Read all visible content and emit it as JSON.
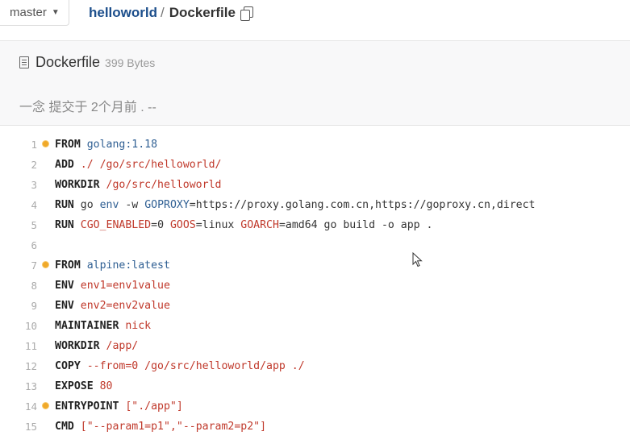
{
  "topbar": {
    "branch": "master",
    "repo": "helloworld",
    "separator": "/",
    "file": "Dockerfile"
  },
  "file_header": {
    "name": "Dockerfile",
    "size": "399 Bytes",
    "commit": "一念 提交于 2个月前 . --"
  },
  "code": {
    "lines": [
      {
        "n": "1",
        "marker": true,
        "segs": [
          [
            "kw",
            "FROM"
          ],
          [
            "plain",
            " "
          ],
          [
            "nm",
            "golang:1.18"
          ]
        ]
      },
      {
        "n": "2",
        "marker": false,
        "segs": [
          [
            "kw",
            "ADD"
          ],
          [
            "plain",
            " "
          ],
          [
            "arg",
            "./ /go/src/helloworld/"
          ]
        ]
      },
      {
        "n": "3",
        "marker": false,
        "segs": [
          [
            "kw",
            "WORKDIR"
          ],
          [
            "plain",
            " "
          ],
          [
            "arg",
            "/go/src/helloworld"
          ]
        ]
      },
      {
        "n": "4",
        "marker": false,
        "segs": [
          [
            "kw",
            "RUN"
          ],
          [
            "plain",
            " go "
          ],
          [
            "nm",
            "env"
          ],
          [
            "plain",
            " -w "
          ],
          [
            "nm",
            "GOPROXY"
          ],
          [
            "plain",
            "=https://proxy.golang.com.cn,https://goproxy.cn,direct"
          ]
        ]
      },
      {
        "n": "5",
        "marker": false,
        "segs": [
          [
            "kw",
            "RUN"
          ],
          [
            "plain",
            " "
          ],
          [
            "arg",
            "CGO_ENABLED"
          ],
          [
            "plain",
            "=0 "
          ],
          [
            "arg",
            "GOOS"
          ],
          [
            "plain",
            "=linux "
          ],
          [
            "arg",
            "GOARCH"
          ],
          [
            "plain",
            "=amd64 go build -o app ."
          ]
        ]
      },
      {
        "n": "6",
        "marker": false,
        "segs": []
      },
      {
        "n": "7",
        "marker": true,
        "segs": [
          [
            "kw",
            "FROM"
          ],
          [
            "plain",
            " "
          ],
          [
            "nm",
            "alpine:latest"
          ]
        ]
      },
      {
        "n": "8",
        "marker": false,
        "segs": [
          [
            "kw",
            "ENV"
          ],
          [
            "plain",
            " "
          ],
          [
            "arg",
            "env1=env1value"
          ]
        ]
      },
      {
        "n": "9",
        "marker": false,
        "segs": [
          [
            "kw",
            "ENV"
          ],
          [
            "plain",
            " "
          ],
          [
            "arg",
            "env2=env2value"
          ]
        ]
      },
      {
        "n": "10",
        "marker": false,
        "segs": [
          [
            "kw",
            "MAINTAINER"
          ],
          [
            "plain",
            " "
          ],
          [
            "arg",
            "nick"
          ]
        ]
      },
      {
        "n": "11",
        "marker": false,
        "segs": [
          [
            "kw",
            "WORKDIR"
          ],
          [
            "plain",
            " "
          ],
          [
            "arg",
            "/app/"
          ]
        ]
      },
      {
        "n": "12",
        "marker": false,
        "segs": [
          [
            "kw",
            "COPY"
          ],
          [
            "plain",
            " "
          ],
          [
            "arg",
            "--from=0 /go/src/helloworld/app ./"
          ]
        ]
      },
      {
        "n": "13",
        "marker": false,
        "segs": [
          [
            "kw",
            "EXPOSE"
          ],
          [
            "plain",
            " "
          ],
          [
            "arg",
            "80"
          ]
        ]
      },
      {
        "n": "14",
        "marker": true,
        "segs": [
          [
            "kw",
            "ENTRYPOINT"
          ],
          [
            "plain",
            " "
          ],
          [
            "arg",
            "[\"./app\"]"
          ]
        ]
      },
      {
        "n": "15",
        "marker": false,
        "segs": [
          [
            "kw",
            "CMD"
          ],
          [
            "plain",
            " "
          ],
          [
            "arg",
            "[\"--param1=p1\",\"--param2=p2\"]"
          ]
        ]
      }
    ]
  },
  "icons": {
    "branch_caret": "caret-down-icon",
    "copy": "copy-icon",
    "file": "file-icon",
    "marker": "warning-dot-icon",
    "cursor": "mouse-cursor-icon"
  },
  "colors": {
    "repo_link": "#1d4f8c",
    "keyword": "#222222",
    "argument": "#c0392b",
    "name": "#2f5f93",
    "marker": "#f0a92a"
  }
}
